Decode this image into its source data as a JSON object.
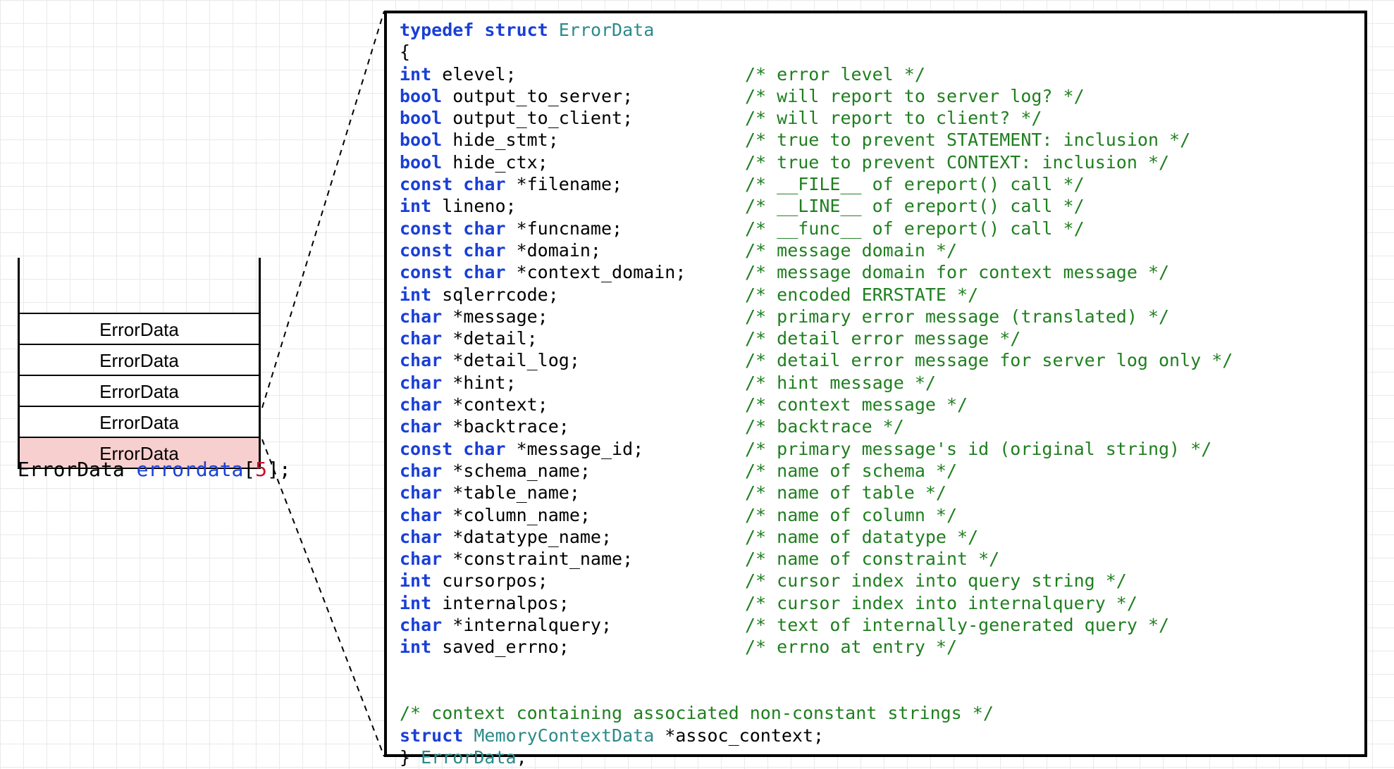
{
  "stack": {
    "items": [
      "ErrorData",
      "ErrorData",
      "ErrorData",
      "ErrorData",
      "ErrorData"
    ],
    "highlight_index": 4
  },
  "caption": {
    "type": "ErrorData",
    "var": "errordata",
    "index_open": "[",
    "index_val": "5",
    "index_close": "];"
  },
  "code": {
    "typedef": "typedef",
    "struct_kw": "struct",
    "struct_name": "ErrorData",
    "open_brace": "{",
    "fields": [
      {
        "t": "int",
        "n": " elevel;",
        "c": "/* error level */"
      },
      {
        "t": "bool",
        "n": " output_to_server;",
        "c": "/* will report to server log? */"
      },
      {
        "t": "bool",
        "n": " output_to_client;",
        "c": "/* will report to client? */"
      },
      {
        "t": "bool",
        "n": " hide_stmt;",
        "c": "/* true to prevent STATEMENT: inclusion */"
      },
      {
        "t": "bool",
        "n": " hide_ctx;",
        "c": "/* true to prevent CONTEXT: inclusion */"
      },
      {
        "t": "const char",
        "n": " *filename;",
        "c": "/* __FILE__ of ereport() call */"
      },
      {
        "t": "int",
        "n": " lineno;",
        "c": "/* __LINE__ of ereport() call */"
      },
      {
        "t": "const char",
        "n": " *funcname;",
        "c": "/* __func__ of ereport() call */"
      },
      {
        "t": "const char",
        "n": " *domain;",
        "c": "/* message domain */"
      },
      {
        "t": "const char",
        "n": " *context_domain;",
        "c": "/* message domain for context message */"
      },
      {
        "t": "int",
        "n": " sqlerrcode;",
        "c": "/* encoded ERRSTATE */"
      },
      {
        "t": "char",
        "n": " *message;",
        "c": "/* primary error message (translated) */"
      },
      {
        "t": "char",
        "n": " *detail;",
        "c": "/* detail error message */"
      },
      {
        "t": "char",
        "n": " *detail_log;",
        "c": "/* detail error message for server log only */"
      },
      {
        "t": "char",
        "n": " *hint;",
        "c": "/* hint message */"
      },
      {
        "t": "char",
        "n": " *context;",
        "c": "/* context message */"
      },
      {
        "t": "char",
        "n": " *backtrace;",
        "c": "/* backtrace */"
      },
      {
        "t": "const char",
        "n": " *message_id;",
        "c": "/* primary message's id (original string) */"
      },
      {
        "t": "char",
        "n": " *schema_name;",
        "c": "/* name of schema */"
      },
      {
        "t": "char",
        "n": " *table_name;",
        "c": "/* name of table */"
      },
      {
        "t": "char",
        "n": " *column_name;",
        "c": "/* name of column */"
      },
      {
        "t": "char",
        "n": " *datatype_name;",
        "c": "/* name of datatype */"
      },
      {
        "t": "char",
        "n": " *constraint_name;",
        "c": "/* name of constraint */"
      },
      {
        "t": "int",
        "n": " cursorpos;",
        "c": "/* cursor index into query string */"
      },
      {
        "t": "int",
        "n": " internalpos;",
        "c": "/* cursor index into internalquery */"
      },
      {
        "t": "char",
        "n": " *internalquery;",
        "c": "/* text of internally-generated query */"
      },
      {
        "t": "int",
        "n": " saved_errno;",
        "c": "/* errno at entry */"
      }
    ],
    "blank": "",
    "assoc_comment": "/* context containing associated non-constant strings */",
    "assoc_struct_kw": "struct",
    "assoc_struct_name": "MemoryContextData",
    "assoc_rest": " *assoc_context;",
    "close_brace": "}",
    "close_name": " ErrorData",
    "close_semi": ";"
  }
}
